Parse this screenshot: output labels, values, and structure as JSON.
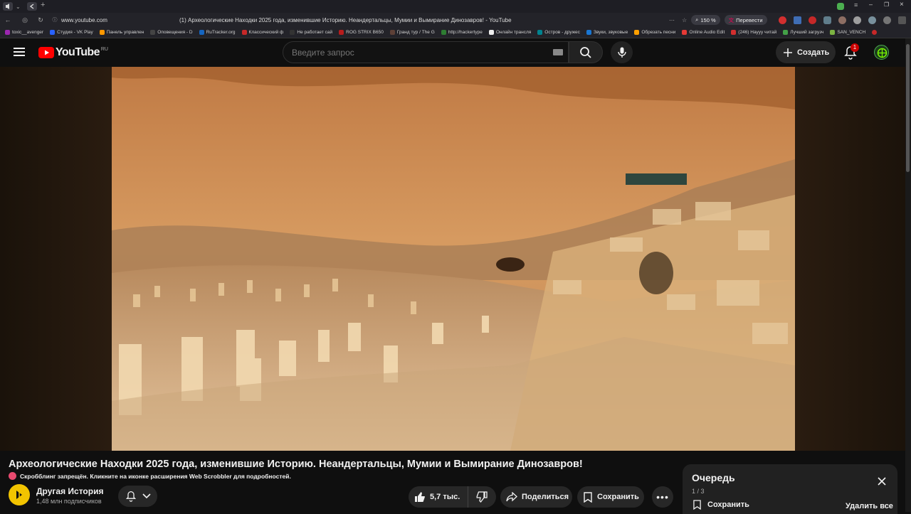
{
  "browser": {
    "url": "www.youtube.com",
    "tab_title": "(1) Археологические Находки 2025 года, изменившие Историю. Неандертальцы, Мумии и Вымирание Динозавров! - YouTube",
    "zoom": "150 %",
    "translate_label": "Перевести"
  },
  "bookmarks": [
    "toxic__avenger",
    "Студия - VK Play",
    "Панель управлен",
    "Оповещения - D",
    "RuTracker.org",
    "Классический ф",
    "Не работает сай",
    "ROG STRIX B650",
    "Гранд тур / The G",
    "http://hackertype",
    "Онлайн трансля",
    "Остров - дружес",
    "Звуки, звуковые",
    "Обрезать песни",
    "Online Audio Edit",
    "(246) Наууу читай",
    "Лучший загрузч",
    "SAN_VENCH"
  ],
  "youtube": {
    "logo_text": "YouTube",
    "region": "RU",
    "search_placeholder": "Введите запрос",
    "create_label": "Создать",
    "notif_count": "1"
  },
  "video": {
    "title": "Археологические Находки 2025 года, изменившие Историю. Неандертальцы, Мумии и Вымирание Динозавров!",
    "scrobble_notice": "Скробблинг запрещён. Кликните на иконке расширения Web Scrobbler для подробностей.",
    "channel_name": "Другая История",
    "subscribers": "1,48 млн подписчиков",
    "likes": "5,7 тыс.",
    "share_label": "Поделиться",
    "save_label": "Сохранить"
  },
  "queue": {
    "title": "Очередь",
    "position": "1 / 3",
    "save_label": "Сохранить",
    "delete_all_label": "Удалить все"
  },
  "colors": {
    "brand_red": "#ff0000",
    "bg": "#0f0f0f",
    "button_bg": "#272727"
  }
}
